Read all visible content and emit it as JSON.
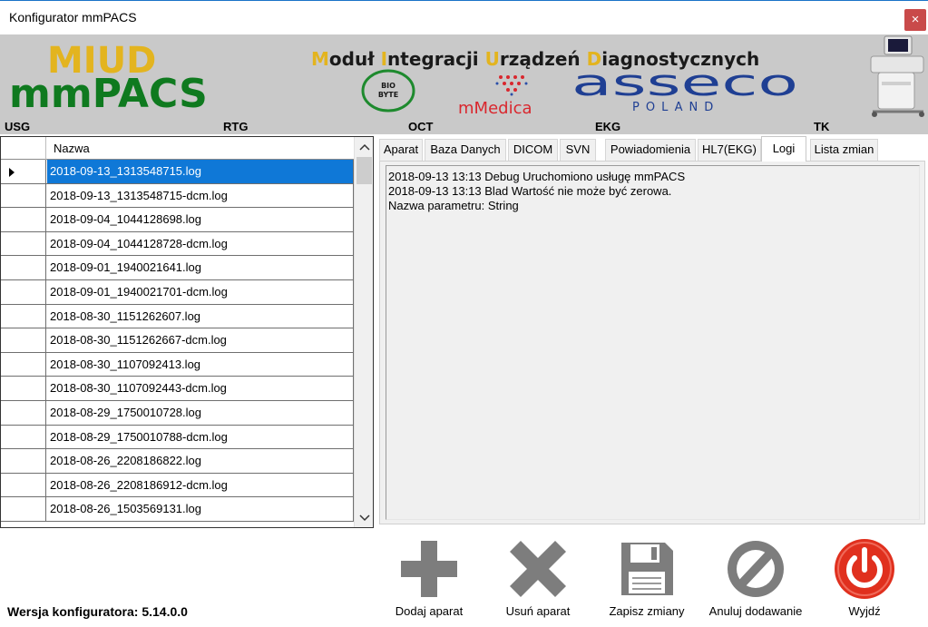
{
  "window": {
    "title": "Konfigurator mmPACS",
    "close_glyph": "×"
  },
  "banner": {
    "logo_top": "MIUD",
    "logo_bottom": "mmPACS",
    "tagline_words": [
      {
        "initial": "M",
        "rest": "oduł "
      },
      {
        "initial": "I",
        "rest": "ntegracji "
      },
      {
        "initial": "U",
        "rest": "rządzeń "
      },
      {
        "initial": "D",
        "rest": "iagnostycznych"
      }
    ],
    "partner_biobyte_top": "BIO",
    "partner_biobyte_bottom": "BYTE",
    "partner_mmedica": "mMedica",
    "partner_asseco": "asseco",
    "partner_asseco_sub": "POLAND",
    "colors": {
      "background": "#c9c9c9",
      "miud_yellow": "#e3b41f",
      "mmpacs_green": "#0f7a1f",
      "tagline_initial": "#e3b41f",
      "tagline_text": "#1a1a1a",
      "asseco_blue": "#1f3f93",
      "mmedica_red": "#d9272e"
    },
    "device_image": "ultrasound-machine-icon"
  },
  "modalities": [
    "USG",
    "RTG",
    "OCT",
    "EKG",
    "TK"
  ],
  "grid": {
    "column_header": "Nazwa",
    "scroll_up_glyph": "^",
    "scroll_down_glyph": "v",
    "rows": [
      "2018-09-13_1313548715.log",
      "2018-09-13_1313548715-dcm.log",
      "2018-09-04_1044128698.log",
      "2018-09-04_1044128728-dcm.log",
      "2018-09-01_1940021641.log",
      "2018-09-01_1940021701-dcm.log",
      "2018-08-30_1151262607.log",
      "2018-08-30_1151262667-dcm.log",
      "2018-08-30_1107092413.log",
      "2018-08-30_1107092443-dcm.log",
      "2018-08-29_1750010728.log",
      "2018-08-29_1750010788-dcm.log",
      "2018-08-26_2208186822.log",
      "2018-08-26_2208186912-dcm.log",
      "2018-08-26_1503569131.log"
    ],
    "selected_index": 0,
    "selection_color": "#0f78d7"
  },
  "tabs": {
    "items": [
      "Aparat",
      "Baza Danych",
      "DICOM",
      "SVN",
      "Powiadomienia",
      "HL7(EKG)",
      "Logi",
      "Lista zmian"
    ],
    "active": "Logi"
  },
  "log_text": "2018-09-13 13:13 Debug Uruchomiono usługę mmPACS\n2018-09-13 13:13 Blad Wartość nie może być zerowa.\nNazwa parametru: String",
  "footer": {
    "version_label": "Wersja konfiguratora: 5.14.0.0",
    "buttons": {
      "add": "Dodaj aparat",
      "remove": "Usuń aparat",
      "save": "Zapisz zmiany",
      "cancel": "Anuluj dodawanie",
      "exit": "Wyjdź"
    },
    "colors": {
      "gray_icon": "#7d7d7d",
      "exit_red": "#e0301e"
    }
  }
}
